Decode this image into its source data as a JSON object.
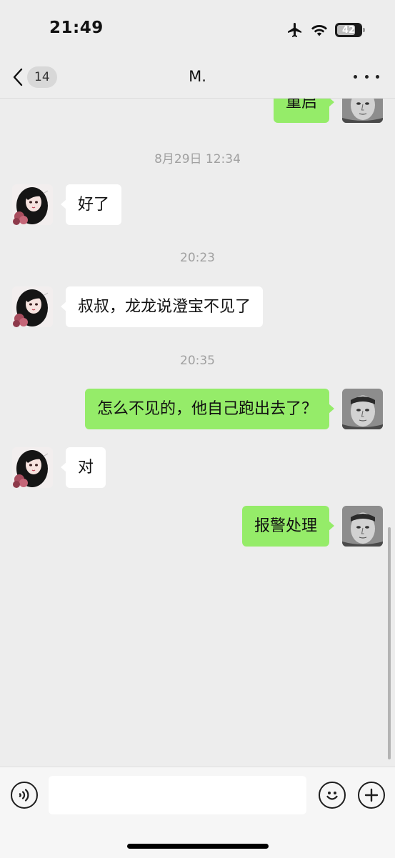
{
  "status_bar": {
    "time": "21:49",
    "battery": "42"
  },
  "nav": {
    "unread_count": "14",
    "title": "M."
  },
  "messages": [
    {
      "type": "out",
      "text": "重启"
    },
    {
      "type": "time",
      "text": "8月29日 12:34"
    },
    {
      "type": "in",
      "text": "好了"
    },
    {
      "type": "time",
      "text": "20:23"
    },
    {
      "type": "in",
      "text": "叔叔，龙龙说澄宝不见了"
    },
    {
      "type": "time",
      "text": "20:35"
    },
    {
      "type": "out",
      "text": "怎么不见的，他自己跑出去了？"
    },
    {
      "type": "in",
      "text": "对"
    },
    {
      "type": "out",
      "text": "报警处理"
    }
  ],
  "input": {
    "value": "",
    "placeholder": ""
  },
  "colors": {
    "background": "#ededed",
    "bubble_out": "#95ec69",
    "bubble_in": "#ffffff",
    "timestamp": "#a0a0a0"
  },
  "icons": {
    "voice": "voice-icon",
    "emoji": "emoji-icon",
    "add": "plus-icon",
    "back": "chevron-left-icon",
    "more": "more-icon"
  }
}
